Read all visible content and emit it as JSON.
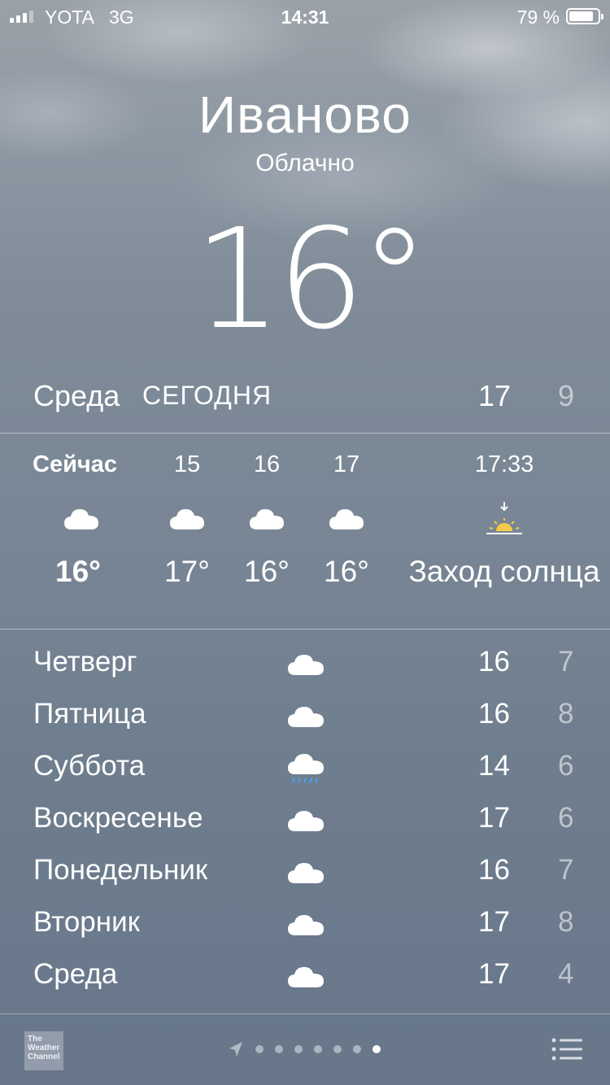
{
  "status_bar": {
    "carrier": "YOTA",
    "network": "3G",
    "time": "14:31",
    "battery": "79 %",
    "battery_level": 0.79
  },
  "location": {
    "city": "Иваново",
    "condition": "Облачно",
    "temperature": "16°"
  },
  "today": {
    "day": "Среда",
    "label": "СЕГОДНЯ",
    "high": "17",
    "low": "9"
  },
  "hourly": [
    {
      "hour": "Сейчас",
      "icon": "cloud-icon",
      "temp": "16°"
    },
    {
      "hour": "15",
      "icon": "cloud-icon",
      "temp": "17°"
    },
    {
      "hour": "16",
      "icon": "cloud-icon",
      "temp": "16°"
    },
    {
      "hour": "17",
      "icon": "cloud-icon",
      "temp": "16°"
    },
    {
      "hour": "17:33",
      "icon": "sunset-icon",
      "temp": "Заход солнца"
    }
  ],
  "daily": [
    {
      "day": "Четверг",
      "icon": "cloud-icon",
      "high": "16",
      "low": "7"
    },
    {
      "day": "Пятница",
      "icon": "cloud-icon",
      "high": "16",
      "low": "8"
    },
    {
      "day": "Суббота",
      "icon": "rain-cloud-icon",
      "high": "14",
      "low": "6"
    },
    {
      "day": "Воскресенье",
      "icon": "cloud-icon",
      "high": "17",
      "low": "6"
    },
    {
      "day": "Понедельник",
      "icon": "cloud-icon",
      "high": "16",
      "low": "7"
    },
    {
      "day": "Вторник",
      "icon": "cloud-icon",
      "high": "17",
      "low": "8"
    },
    {
      "day": "Среда",
      "icon": "cloud-icon",
      "high": "17",
      "low": "4"
    }
  ],
  "footer": {
    "brand": "The Weather Channel",
    "page_count": 7,
    "active_page": 7,
    "colors": {
      "sun": "#f6c94a",
      "rain": "#4aa3ff"
    }
  }
}
